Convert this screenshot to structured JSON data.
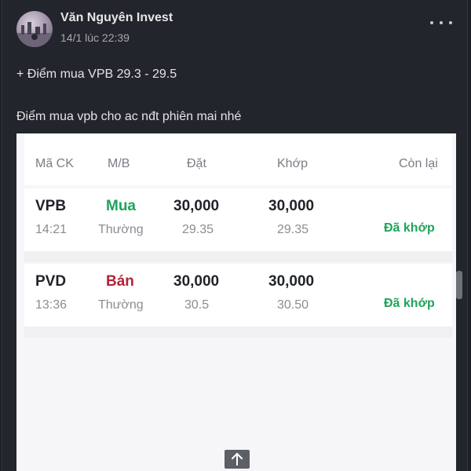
{
  "post": {
    "author": "Văn Nguyên Invest",
    "timestamp": "14/1 lúc 22:39",
    "line1": "+ Điểm mua VPB 29.3 - 29.5",
    "line2": "Điểm mua vpb cho ac nđt phiên mai nhé"
  },
  "table": {
    "headers": [
      "Mã CK",
      "M/B",
      "Đặt",
      "Khớp",
      "Còn lại"
    ],
    "rows": [
      {
        "symbol": "VPB",
        "time": "14:21",
        "side": "Mua",
        "side_type": "Thường",
        "order_qty": "30,000",
        "order_price": "29.35",
        "match_qty": "30,000",
        "match_price": "29.35",
        "status": "Đã khớp"
      },
      {
        "symbol": "PVD",
        "time": "13:36",
        "side": "Bán",
        "side_type": "Thường",
        "order_qty": "30,000",
        "order_price": "30.5",
        "match_qty": "30,000",
        "match_price": "30.50",
        "status": "Đã khớp"
      }
    ]
  },
  "colors": {
    "buy": "#1fa35a",
    "sell": "#b3243a",
    "status": "#1fa35a"
  },
  "icons": {
    "more": "more-horizontal-icon",
    "scroll_top": "arrow-up-icon"
  }
}
